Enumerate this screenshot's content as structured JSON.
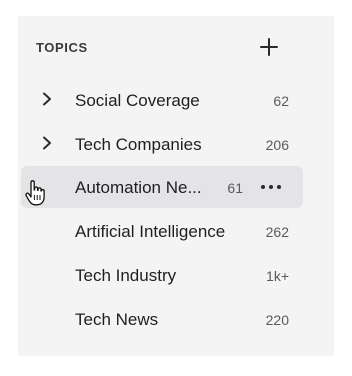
{
  "header": {
    "title": "TOPICS",
    "add_icon": "plus-icon"
  },
  "topics": [
    {
      "label": "Social Coverage",
      "count": "62",
      "expandable": true
    },
    {
      "label": "Tech Companies",
      "count": "206",
      "expandable": true
    },
    {
      "label": "Automation Ne...",
      "count": "61",
      "expandable": false,
      "hovered": true,
      "more_icon": "more-horizontal-icon"
    },
    {
      "label": "Artificial Intelligence",
      "count": "262",
      "expandable": false
    },
    {
      "label": "Tech Industry",
      "count": "1k+",
      "expandable": false
    },
    {
      "label": "Tech News",
      "count": "220",
      "expandable": false
    }
  ],
  "colors": {
    "panel_bg": "#f4f4f5",
    "hover_bg": "#e4e4e6",
    "text": "#1f1f21",
    "count_text": "#5a5a5e"
  }
}
